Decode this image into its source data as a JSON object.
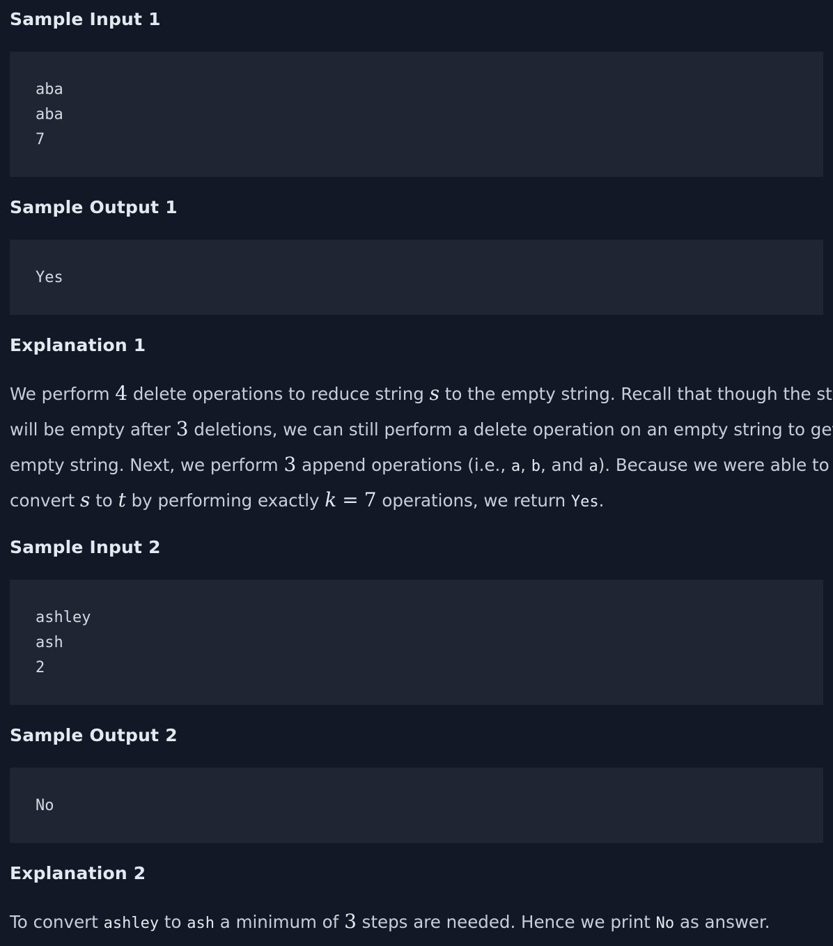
{
  "sections": {
    "sample_input_1": {
      "title": "Sample Input 1",
      "lines": [
        "aba",
        "aba",
        "7"
      ]
    },
    "sample_output_1": {
      "title": "Sample Output 1",
      "lines": [
        "Yes"
      ]
    },
    "explanation_1": {
      "title": "Explanation 1",
      "l1_a": "We perform ",
      "l1_m1": "4",
      "l1_b": " delete operations to reduce string ",
      "l1_m2": "s",
      "l1_c": " to the empty string. Recall that though the string",
      "l2_a": "will be empty after ",
      "l2_m1": "3",
      "l2_b": " deletions, we can still perform a delete operation on an empty string to get the",
      "l3_a": "empty string. Next, we perform ",
      "l3_m1": "3",
      "l3_b": " append operations (i.e., ",
      "l3_c1": "a",
      "l3_c": ", ",
      "l3_c2": "b",
      "l3_d": ", and ",
      "l3_c3": "a",
      "l3_e": "). Because we were able to",
      "l4_a": "convert ",
      "l4_m1": "s",
      "l4_b": " to ",
      "l4_m2": "t",
      "l4_c": " by performing exactly ",
      "l4_m3": "k",
      "l4_eq": "=",
      "l4_m4": "7",
      "l4_d": " operations, we return ",
      "l4_code": "Yes",
      "l4_e": "."
    },
    "sample_input_2": {
      "title": "Sample Input 2",
      "lines": [
        "ashley",
        "ash",
        "2"
      ]
    },
    "sample_output_2": {
      "title": "Sample Output 2",
      "lines": [
        "No"
      ]
    },
    "explanation_2": {
      "title": "Explanation 2",
      "a": "To convert ",
      "code1": "ashley",
      "b": " to ",
      "code2": "ash",
      "c": " a minimum of ",
      "m1": "3",
      "d": " steps are needed. Hence we print ",
      "code3": "No",
      "e": " as answer."
    }
  }
}
